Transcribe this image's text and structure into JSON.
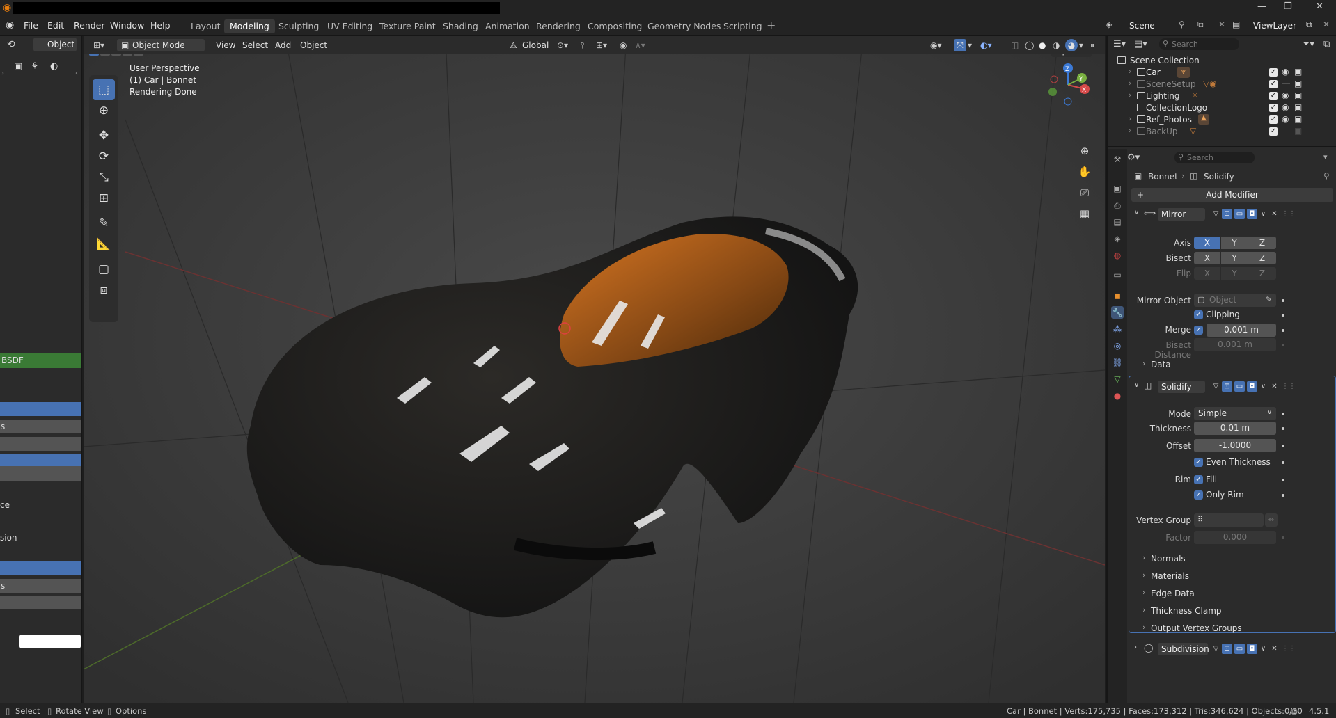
{
  "app": {
    "menus": [
      "File",
      "Edit",
      "Render",
      "Window",
      "Help"
    ],
    "workspaces": [
      "Layout",
      "Modeling",
      "Sculpting",
      "UV Editing",
      "Texture Paint",
      "Shading",
      "Animation",
      "Rendering",
      "Compositing",
      "Geometry Nodes",
      "Scripting"
    ],
    "active_workspace": "Modeling",
    "scene": "Scene",
    "view_layer": "ViewLayer"
  },
  "left_panel": {
    "mode": "Object",
    "node_header": "BSDF",
    "fragments": [
      "s",
      "ce",
      "sion",
      "s"
    ]
  },
  "viewport": {
    "mode": "Object Mode",
    "menus": [
      "View",
      "Select",
      "Add",
      "Object"
    ],
    "transform": "Global",
    "options": "Options",
    "info": [
      "User Perspective",
      "(1) Car | Bonnet",
      "Rendering Done"
    ],
    "gizmo_axes": [
      "Z",
      "Y",
      "X"
    ]
  },
  "outliner": {
    "search_placeholder": "Search",
    "root": "Scene Collection",
    "rows": [
      {
        "name": "Car",
        "dim": false
      },
      {
        "name": "SceneSetup",
        "dim": true
      },
      {
        "name": "Lighting",
        "dim": false
      },
      {
        "name": "CollectionLogo",
        "dim": false
      },
      {
        "name": "Ref_Photos",
        "dim": false
      },
      {
        "name": "BackUp",
        "dim": true
      }
    ]
  },
  "properties": {
    "search_placeholder": "Search",
    "breadcrumb": [
      "Bonnet",
      "Solidify"
    ],
    "add_modifier": "Add Modifier",
    "mirror": {
      "name": "Mirror",
      "axis_label": "Axis",
      "bisect_label": "Bisect",
      "flip_label": "Flip",
      "axes": [
        "X",
        "Y",
        "Z"
      ],
      "mirror_object_label": "Mirror Object",
      "mirror_object_placeholder": "Object",
      "clipping": "Clipping",
      "merge_label": "Merge",
      "merge_value": "0.001 m",
      "bisect_distance_label": "Bisect Distance",
      "bisect_distance_value": "0.001 m",
      "data": "Data"
    },
    "solidify": {
      "name": "Solidify",
      "mode_label": "Mode",
      "mode_value": "Simple",
      "thickness_label": "Thickness",
      "thickness_value": "0.01 m",
      "offset_label": "Offset",
      "offset_value": "-1.0000",
      "even_thickness": "Even Thickness",
      "rim_label": "Rim",
      "fill": "Fill",
      "only_rim": "Only Rim",
      "vertex_group_label": "Vertex Group",
      "factor_label": "Factor",
      "factor_value": "0.000",
      "subpanels": [
        "Normals",
        "Materials",
        "Edge Data",
        "Thickness Clamp",
        "Output Vertex Groups"
      ]
    },
    "subdivision": {
      "name": "Subdivision"
    }
  },
  "status": {
    "select": "Select",
    "rotate": "Rotate View",
    "options": "Options",
    "stats": "Car | Bonnet | Verts:175,735 | Faces:173,312 | Tris:346,624 | Objects:0/30",
    "version": "4.5.1"
  },
  "colors": {
    "accent": "#4772b3",
    "node_green": "#3a7a35",
    "car_body": "#1f1f1f",
    "glass": "#c06a1e"
  }
}
